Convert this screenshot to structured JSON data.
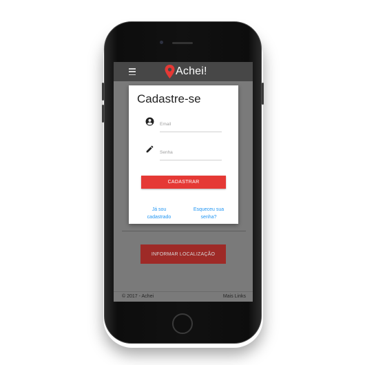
{
  "app": {
    "name": "Achei!",
    "accent_color": "#e53935",
    "appbar_color": "#474747"
  },
  "appbar": {
    "menu_icon": "hamburger-menu-icon",
    "logo_icon": "location-pin-icon"
  },
  "signup_modal": {
    "title": "Cadastre-se",
    "email_icon": "account-circle-icon",
    "email_placeholder": "Email",
    "password_icon": "pencil-icon",
    "password_placeholder": "Senha",
    "submit_label": "CADASTRAR",
    "already_registered_line1": "Já sou",
    "already_registered_line2": "cadastrado",
    "forgot_password_line1": "Esqueceu sua",
    "forgot_password_line2": "senha?",
    "link_color": "#2196f3"
  },
  "main": {
    "report_location_label": "INFORMAR LOCALIZAÇÃO"
  },
  "footer": {
    "copyright": "© 2017 - Achei",
    "more_links": "Mais Links"
  }
}
